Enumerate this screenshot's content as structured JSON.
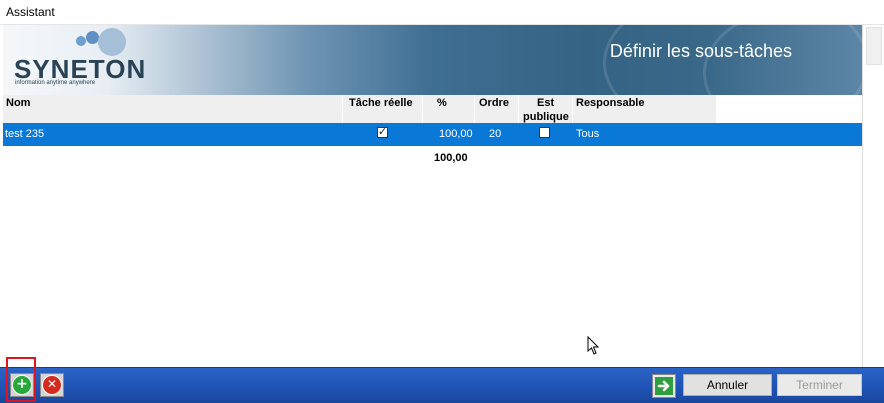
{
  "window": {
    "title": "Assistant"
  },
  "header": {
    "brand": "SYNETON",
    "tagline": "information anytime anywhere",
    "title": "Définir les sous-tâches"
  },
  "grid": {
    "columns": {
      "name": "Nom",
      "real_task": "Tâche réelle",
      "percent": "%",
      "order": "Ordre",
      "public_line1": "Est",
      "public_line2": "publique",
      "responsible": "Responsable"
    },
    "rows": [
      {
        "name": "test 235",
        "real_task": true,
        "percent": "100,00",
        "order": "20",
        "public": false,
        "responsible": "Tous"
      }
    ],
    "total_percent": "100,00"
  },
  "icons": {
    "add": "add-circle-icon",
    "delete": "delete-circle-icon",
    "next": "arrow-right-icon"
  },
  "footer": {
    "cancel_label": "Annuler",
    "finish_label": "Terminer"
  },
  "colors": {
    "selection": "#0a78d7",
    "add": "#26a83a",
    "delete": "#d62a1e",
    "bar": "#1f53b5",
    "highlight": "#e0141e"
  }
}
